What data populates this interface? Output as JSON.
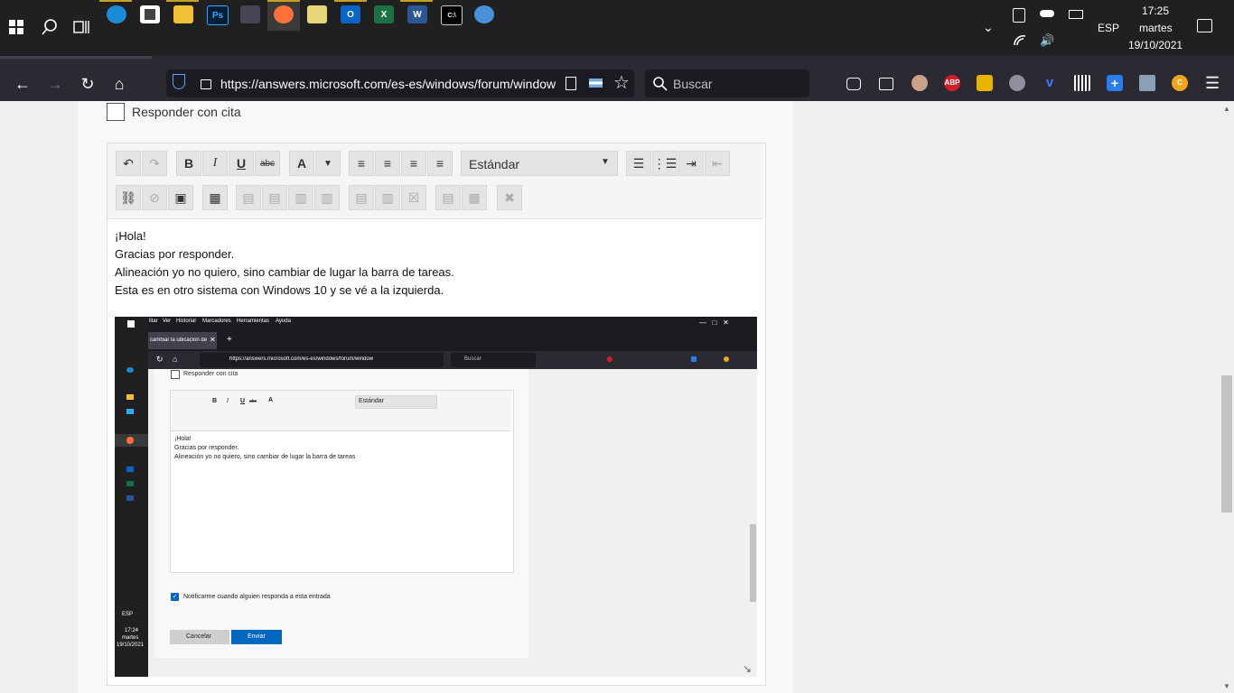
{
  "taskbar": {
    "apps": [
      {
        "name": "start",
        "label": ""
      },
      {
        "name": "search",
        "label": ""
      },
      {
        "name": "task-view",
        "label": ""
      },
      {
        "name": "edge",
        "label": ""
      },
      {
        "name": "store",
        "label": ""
      },
      {
        "name": "explorer",
        "label": ""
      },
      {
        "name": "photoshop",
        "label": "Ps"
      },
      {
        "name": "app",
        "label": ""
      },
      {
        "name": "firefox",
        "label": ""
      },
      {
        "name": "notes",
        "label": ""
      },
      {
        "name": "outlook",
        "label": "O"
      },
      {
        "name": "excel",
        "label": "X"
      },
      {
        "name": "word",
        "label": "W"
      },
      {
        "name": "terminal",
        "label": "C:\\"
      },
      {
        "name": "paint",
        "label": ""
      }
    ],
    "tray": {
      "language": "ESP",
      "time": "17:25",
      "day": "martes",
      "date": "19/10/2021"
    }
  },
  "browser": {
    "url": "https://answers.microsoft.com/es-es/windows/forum/window",
    "search_placeholder": "Buscar",
    "extensions": {
      "abp": "ABP",
      "c": "C"
    }
  },
  "page": {
    "quote_label": "Responder con cita",
    "toolbar": {
      "bold": "B",
      "italic": "I",
      "underline": "U",
      "strike": "abc",
      "font_color": "A",
      "style_select": "Estándar"
    },
    "body_lines": [
      "¡Hola!",
      "Gracias por responder.",
      "Alineación yo no quiero, sino cambiar de lugar la barra de tareas.",
      "Esta es en otro sistema con Windows 10 y se vé a la izquierda."
    ]
  },
  "screenshot": {
    "menu": [
      "litar",
      "Ver",
      "Historial",
      "Marcadores",
      "Herramientas",
      "Ayuda"
    ],
    "tab_title": "cambiar la ubicación de",
    "url": "https://answers.microsoft.com/es-es/windows/forum/window",
    "search": "Buscar",
    "quote_label": "Responder con cita",
    "style_select": "Estándar",
    "toolbar": {
      "bold": "B",
      "italic": "I",
      "underline": "U",
      "strike": "abc",
      "font_color": "A"
    },
    "lines": [
      "¡Hola!",
      "Gracias por responder.",
      "Alineación yo no quiero, sino cambiar de lugar la barra de tareas"
    ],
    "notify_label": "Notificarme cuando alguien responda a esta entrada",
    "cancel": "Cancelar",
    "send": "Enviar",
    "tray": {
      "language": "ESP",
      "time": "17:24",
      "day": "martes",
      "date": "19/10/2021"
    }
  }
}
